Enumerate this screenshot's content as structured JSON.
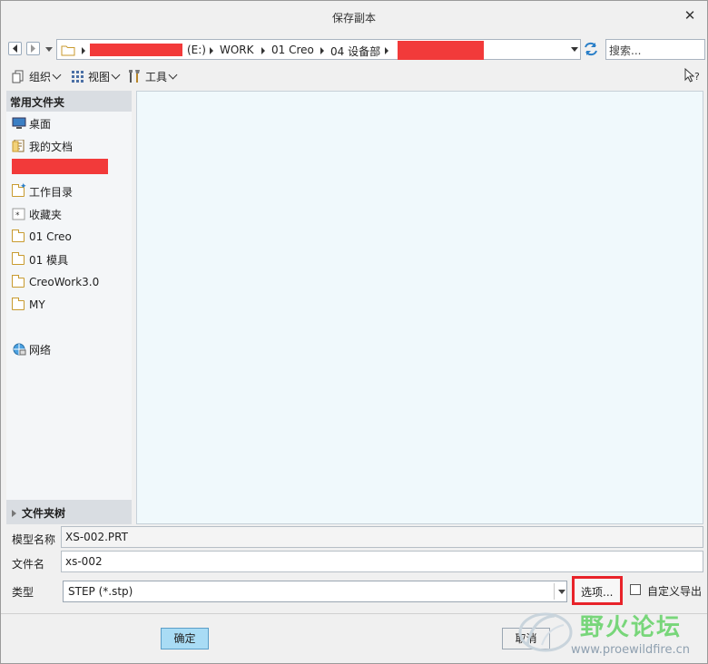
{
  "window": {
    "title": "保存副本"
  },
  "nav": {
    "breadcrumbs": [
      "(E:)",
      "WORK",
      "01 Creo",
      "04 设备部"
    ],
    "search_placeholder": "搜索..."
  },
  "toolbar": {
    "organize_label": "组织",
    "view_label": "视图",
    "tools_label": "工具"
  },
  "sidebar": {
    "header": "常用文件夹",
    "items": [
      {
        "label": "桌面",
        "icon": "desktop-icon"
      },
      {
        "label": "我的文档",
        "icon": "documents-icon"
      },
      {
        "label": "",
        "icon": "folder-icon"
      },
      {
        "label": "工作目录",
        "icon": "workdir-icon"
      },
      {
        "label": "收藏夹",
        "icon": "favorites-icon"
      },
      {
        "label": "01 Creo",
        "icon": "folder-icon"
      },
      {
        "label": "01 模具",
        "icon": "folder-icon"
      },
      {
        "label": "CreoWork3.0",
        "icon": "folder-icon"
      },
      {
        "label": "MY",
        "icon": "folder-icon"
      },
      {
        "label": "网络",
        "icon": "network-icon"
      }
    ],
    "footer": "文件夹树"
  },
  "form": {
    "model_name_label": "模型名称",
    "model_name_value": "XS-002.PRT",
    "file_name_label": "文件名",
    "file_name_value": "xs-002",
    "type_label": "类型",
    "type_value": "STEP (*.stp)",
    "options_label": "选项...",
    "custom_export_label": "自定义导出"
  },
  "buttons": {
    "ok": "确定",
    "cancel": "取消"
  },
  "watermark": {
    "title": "野火论坛",
    "url": "www.proewildfire.cn"
  },
  "colors": {
    "accent": "#a9dcf5",
    "highlight": "#e8232a",
    "redaction": "#f23a3a"
  }
}
